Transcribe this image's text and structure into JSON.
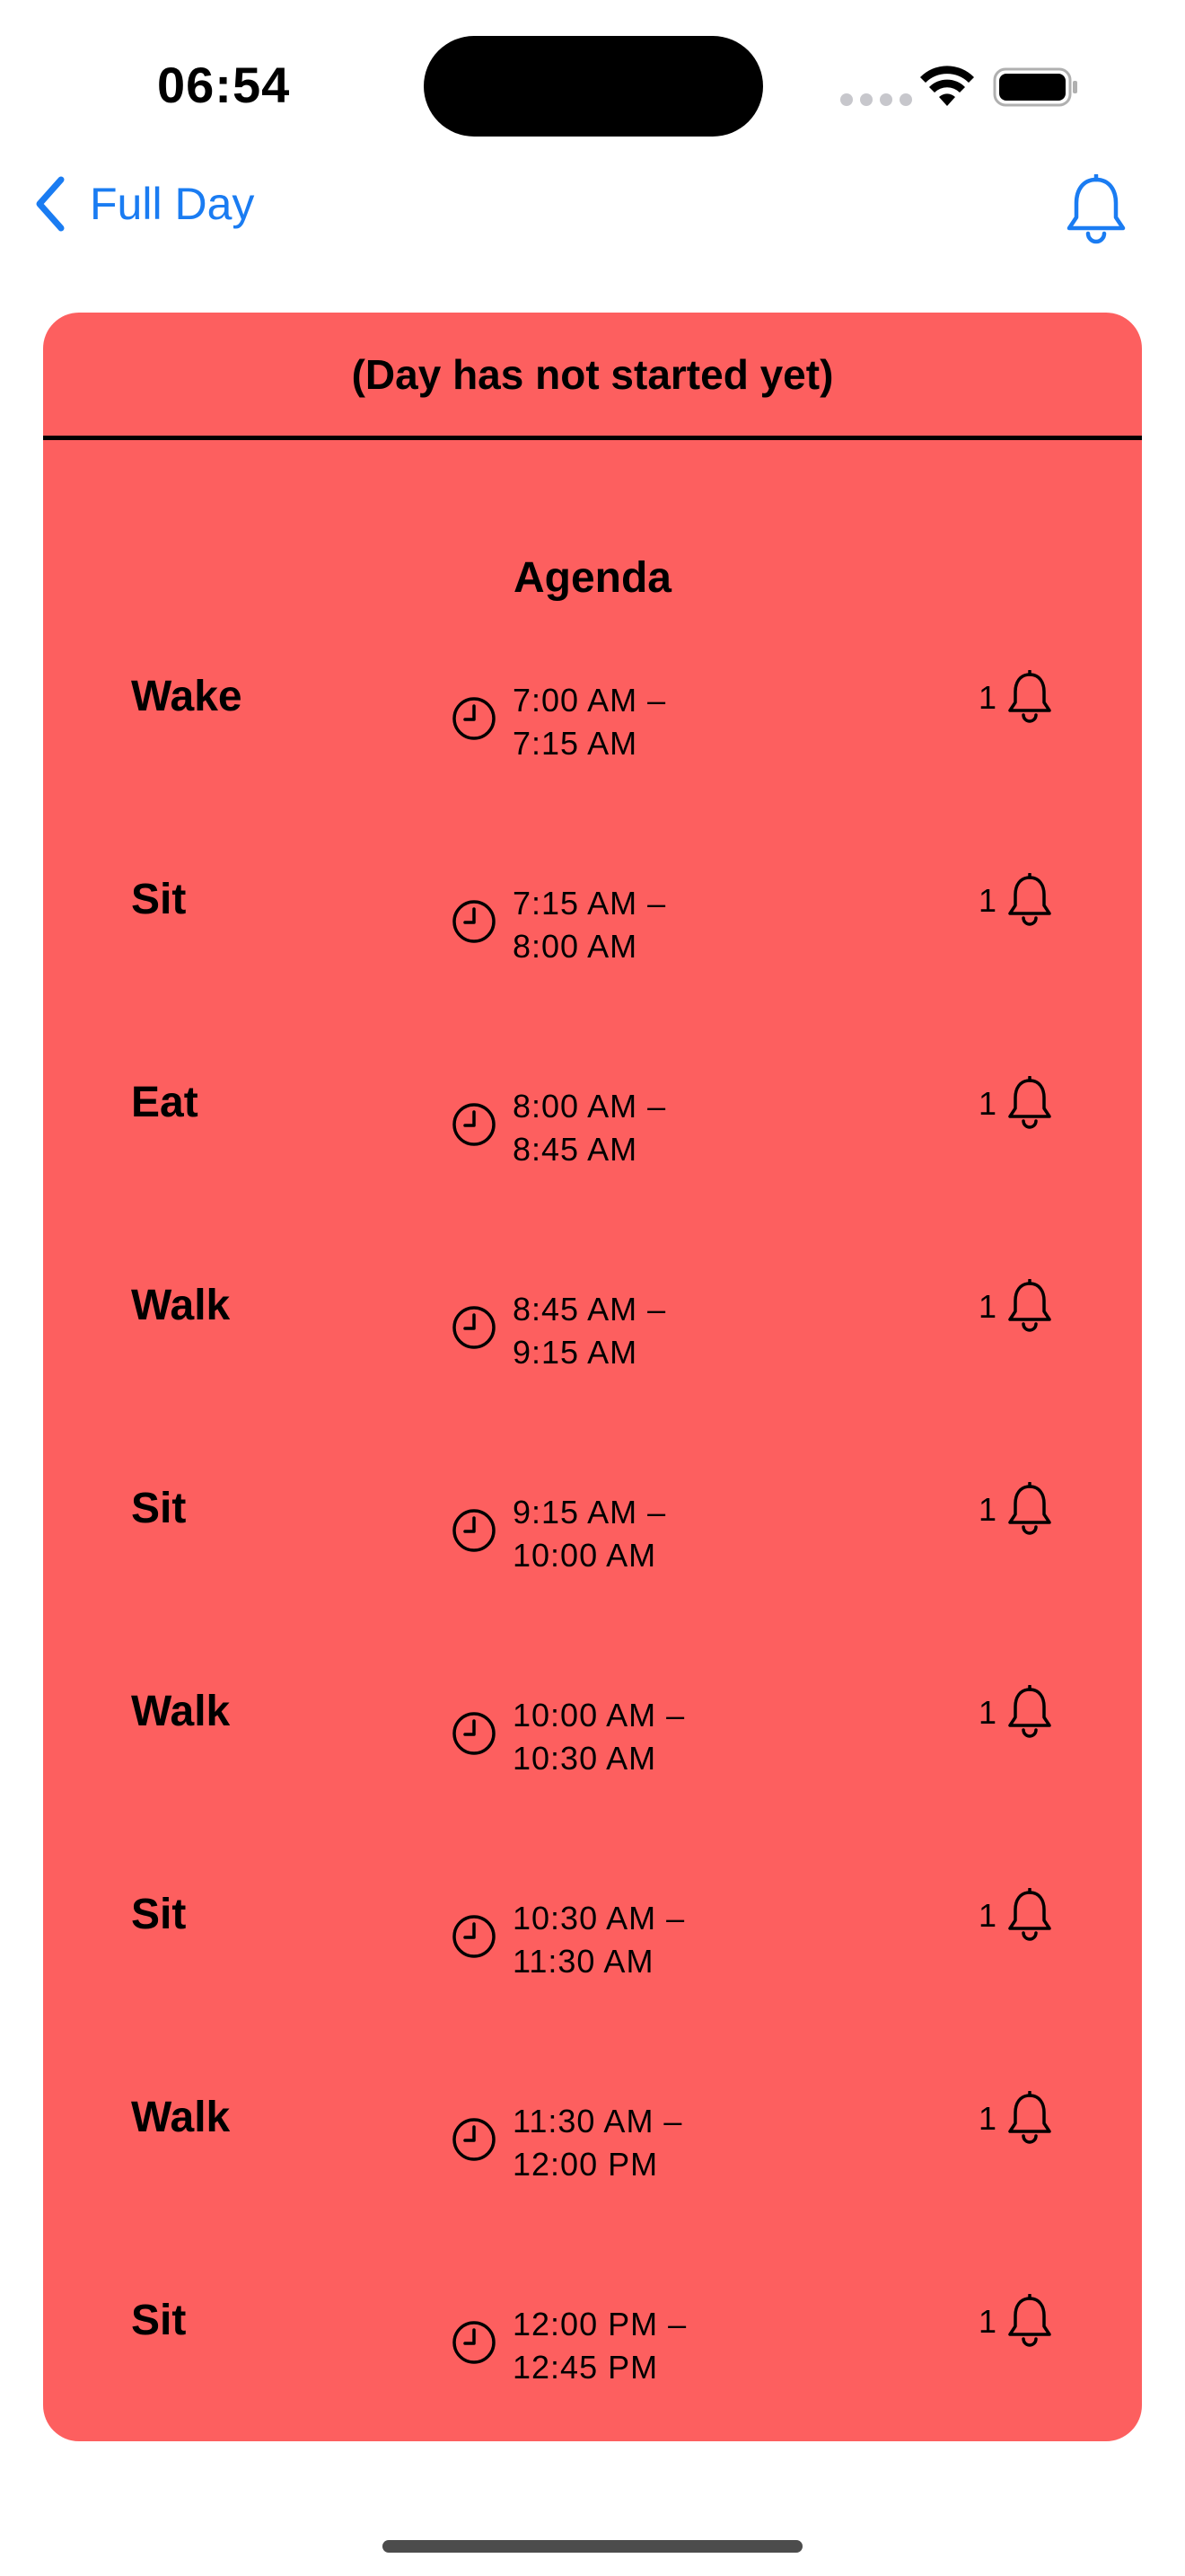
{
  "status_bar": {
    "time": "06:54"
  },
  "nav": {
    "back_label": "Full Day",
    "accent_color": "#1a7cf2"
  },
  "card": {
    "background_color": "#fd5f5f",
    "status_text": "(Day has not started yet)",
    "agenda_title": "Agenda"
  },
  "agenda": [
    {
      "name": "Wake",
      "start": "7:00 AM –",
      "end": "7:15 AM",
      "reminders": "1"
    },
    {
      "name": "Sit",
      "start": "7:15 AM –",
      "end": "8:00 AM",
      "reminders": "1"
    },
    {
      "name": "Eat",
      "start": "8:00 AM –",
      "end": "8:45 AM",
      "reminders": "1"
    },
    {
      "name": "Walk",
      "start": "8:45 AM –",
      "end": "9:15 AM",
      "reminders": "1"
    },
    {
      "name": "Sit",
      "start": "9:15 AM –",
      "end": "10:00 AM",
      "reminders": "1"
    },
    {
      "name": "Walk",
      "start": "10:00 AM –",
      "end": "10:30 AM",
      "reminders": "1"
    },
    {
      "name": "Sit",
      "start": "10:30 AM –",
      "end": "11:30 AM",
      "reminders": "1"
    },
    {
      "name": "Walk",
      "start": "11:30 AM –",
      "end": "12:00 PM",
      "reminders": "1"
    },
    {
      "name": "Sit",
      "start": "12:00 PM –",
      "end": "12:45 PM",
      "reminders": "1"
    }
  ],
  "icons": {
    "status": [
      "cellular-signal-icon",
      "wifi-icon",
      "battery-icon"
    ],
    "nav": [
      "chevron-left-icon",
      "bell-icon"
    ],
    "row": [
      "clock-icon",
      "bell-icon"
    ]
  }
}
